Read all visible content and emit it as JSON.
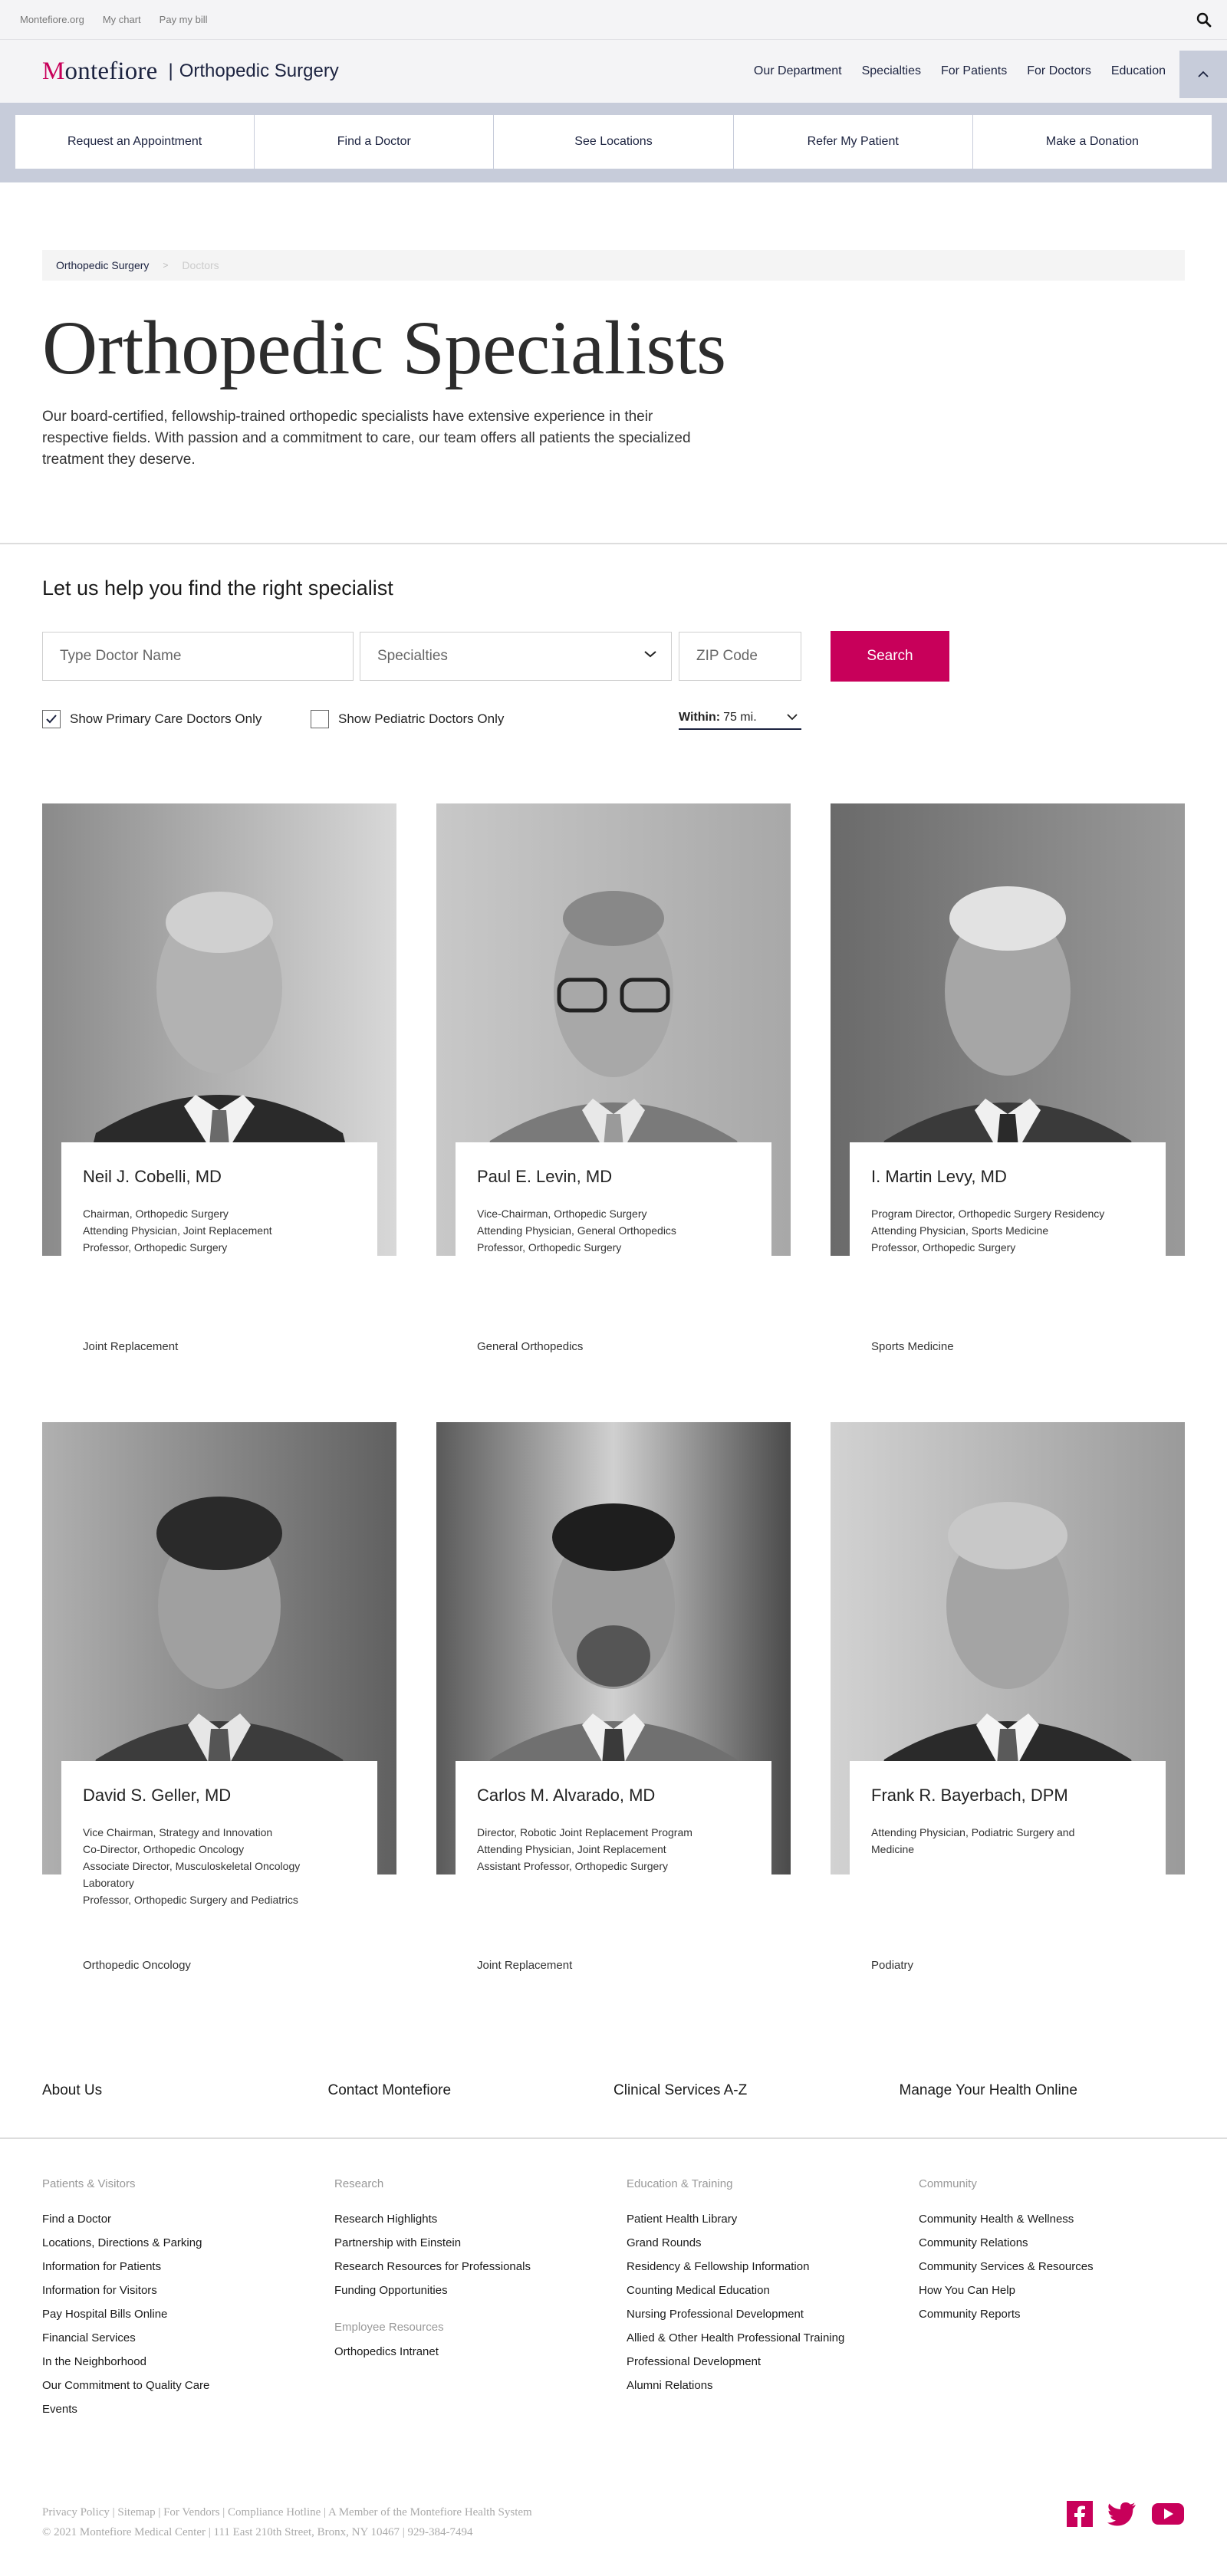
{
  "utility_nav": {
    "links": [
      "Montefiore.org",
      "My chart",
      "Pay my bill"
    ]
  },
  "header": {
    "logo_brand": "Montefiore",
    "logo_brand_initial": "M",
    "logo_brand_rest": "ontefiore",
    "logo_separator": "|",
    "department": "Orthopedic Surgery",
    "nav": [
      "Our Department",
      "Specialties",
      "For Patients",
      "For Doctors",
      "Education"
    ]
  },
  "quick_links": [
    "Request an Appointment",
    "Find a Doctor",
    "See Locations",
    "Refer My Patient",
    "Make a Donation"
  ],
  "breadcrumb": {
    "current": "Orthopedic Surgery",
    "separator": ">",
    "next": "Doctors"
  },
  "hero": {
    "title": "Orthopedic Specialists",
    "description": "Our board-certified, fellowship-trained orthopedic specialists have extensive experience in their respective fields. With passion and a commitment to care, our team offers all patients the specialized treatment they deserve."
  },
  "search": {
    "heading": "Let us help you find the right specialist",
    "name_placeholder": "Type Doctor Name",
    "specialties_label": "Specialties",
    "zip_placeholder": "ZIP Code",
    "button": "Search",
    "primary_care_label": "Show Primary Care Doctors Only",
    "primary_care_checked": true,
    "pediatric_label": "Show Pediatric Doctors Only",
    "pediatric_checked": false,
    "within_label": "Within:",
    "within_value": "75 mi."
  },
  "doctors": [
    {
      "name": "Neil J. Cobelli, MD",
      "titles": [
        "Chairman, Orthopedic Surgery",
        "Attending Physician, Joint Replacement",
        "Professor, Orthopedic Surgery"
      ],
      "specialty": "Joint Replacement"
    },
    {
      "name": "Paul E. Levin, MD",
      "titles": [
        "Vice-Chairman, Orthopedic Surgery",
        "Attending Physician, General Orthopedics",
        "Professor, Orthopedic Surgery"
      ],
      "specialty": "General Orthopedics"
    },
    {
      "name": "I. Martin Levy, MD",
      "titles": [
        "Program Director, Orthopedic Surgery Residency",
        "Attending Physician, Sports Medicine",
        "Professor, Orthopedic Surgery"
      ],
      "specialty": "Sports Medicine"
    },
    {
      "name": "David S. Geller, MD",
      "titles": [
        "Vice Chairman, Strategy and Innovation",
        "Co-Director, Orthopedic Oncology",
        "Associate Director, Musculoskeletal Oncology",
        "Laboratory",
        "Professor, Orthopedic Surgery and Pediatrics"
      ],
      "specialty": "Orthopedic Oncology"
    },
    {
      "name": "Carlos M. Alvarado, MD",
      "titles": [
        "Director, Robotic Joint Replacement Program",
        "Attending Physician, Joint Replacement",
        "Assistant Professor, Orthopedic Surgery"
      ],
      "specialty": "Joint Replacement"
    },
    {
      "name": "Frank R. Bayerbach, DPM",
      "titles": [
        "Attending Physician, Podiatric Surgery and",
        "Medicine"
      ],
      "specialty": "Podiatry"
    }
  ],
  "footer": {
    "top_links": [
      "About Us",
      "Contact Montefiore",
      "Clinical Services A-Z",
      "Manage Your Health Online"
    ],
    "columns": [
      {
        "heading": "Patients & Visitors",
        "items": [
          "Find a Doctor",
          "Locations, Directions & Parking",
          "Information for Patients",
          "Information for Visitors",
          "Pay Hospital Bills Online",
          "Financial Services",
          "In the Neighborhood",
          "Our Commitment to Quality Care",
          "Events"
        ]
      },
      {
        "heading": "Research",
        "items": [
          "Research Highlights",
          "Partnership with Einstein",
          "Research Resources for Professionals",
          "Funding Opportunities"
        ],
        "subheading": "Employee Resources",
        "subitems": [
          "Orthopedics Intranet"
        ]
      },
      {
        "heading": "Education & Training",
        "items": [
          "Patient Health Library",
          "Grand Rounds",
          "Residency & Fellowship Information",
          "Counting Medical Education",
          "Nursing Professional Development",
          "Allied & Other Health Professional Training",
          "Professional Development",
          "Alumni Relations"
        ]
      },
      {
        "heading": "Community",
        "items": [
          "Community Health & Wellness",
          "Community Relations",
          "Community Services & Resources",
          "How You Can Help",
          "Community Reports"
        ]
      }
    ],
    "legal_line1": "Privacy Policy | Sitemap | For Vendors | Compliance Hotline | A Member of the Montefiore Health System",
    "legal_line2": "© 2021 Montefiore Medical Center | 111 East 210th Street, Bronx, NY 10467 | 929-384-7494"
  },
  "colors": {
    "brand": "#c8005a",
    "navy": "#1c2340",
    "band": "#c7ccda"
  },
  "icons": [
    "search-icon",
    "chevron-up-icon",
    "chevron-down-icon",
    "checkmark-icon",
    "facebook-icon",
    "twitter-icon",
    "youtube-icon"
  ]
}
